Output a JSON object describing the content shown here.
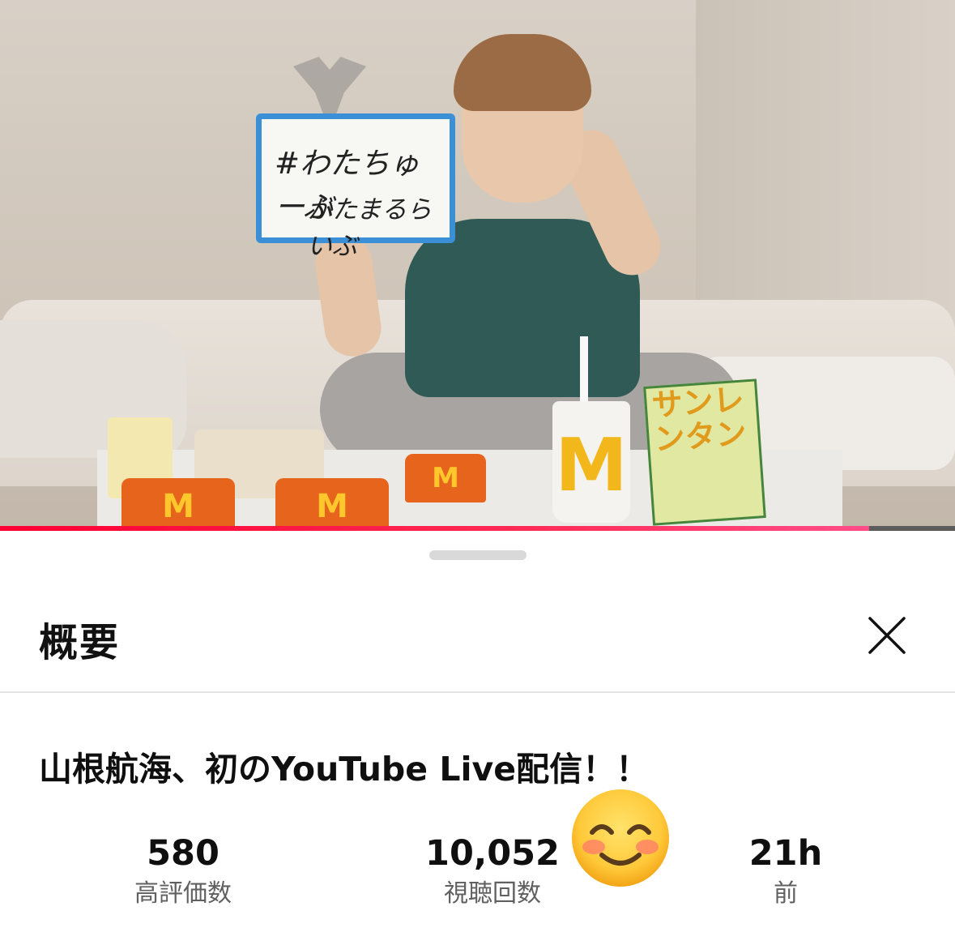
{
  "video": {
    "whiteboard_line1": "#わたちゅーぶ",
    "whiteboard_line2": "かたまるらいぶ",
    "fries_logo": "M",
    "cup_logo": "M",
    "book_text": "サンレンタン",
    "progress_fraction": 0.91,
    "progress_colors": [
      "#ff0033",
      "#ff4d88"
    ]
  },
  "sheet": {
    "title": "概要",
    "close_icon": "close-icon",
    "video_title": "山根航海、初のYouTube Live配信！！",
    "stats": {
      "likes_value": "580",
      "likes_label": "高評価数",
      "views_value": "10,052",
      "views_label": "視聴回数",
      "age_value": "21h",
      "age_label": "前"
    },
    "overlay_emoji": "smiling-face-emoji"
  }
}
